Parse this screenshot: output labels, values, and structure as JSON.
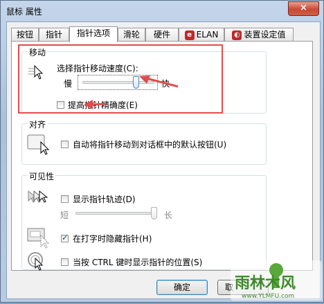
{
  "window": {
    "title": "鼠标 属性",
    "close_symbol": "×"
  },
  "tabs": [
    {
      "label": "按钮"
    },
    {
      "label": "指针"
    },
    {
      "label": "指针选项"
    },
    {
      "label": "滑轮"
    },
    {
      "label": "硬件"
    },
    {
      "label": "ELAN"
    },
    {
      "label": "装置设定值"
    }
  ],
  "motion": {
    "title": "移动",
    "speed_label": "选择指针移动速度(C):",
    "slow": "慢",
    "fast": "快",
    "speed_level": 0.77,
    "precision_label": "提高指针精确度(E)",
    "precision_checked": false
  },
  "snap": {
    "title": "对齐",
    "label": "自动将指针移动到对话框中的默认按钮(U)",
    "checked": false
  },
  "visibility": {
    "title": "可见性",
    "trails_label": "显示指针轨迹(D)",
    "trails_checked": false,
    "short": "短",
    "long": "长",
    "trail_level": 1.0,
    "hide_label": "在打字时隐藏指针(H)",
    "hide_checked": true,
    "ctrl_label": "当按 CTRL 键时显示指针的位置(S)",
    "ctrl_checked": false
  },
  "buttons": {
    "ok": "确定",
    "cancel": "取"
  },
  "watermark": {
    "text": "雨林木风",
    "url": "www.YLMFU.com"
  },
  "colors": {
    "annotation": "#e24c4c",
    "title_bar": "#b7cbe3"
  }
}
